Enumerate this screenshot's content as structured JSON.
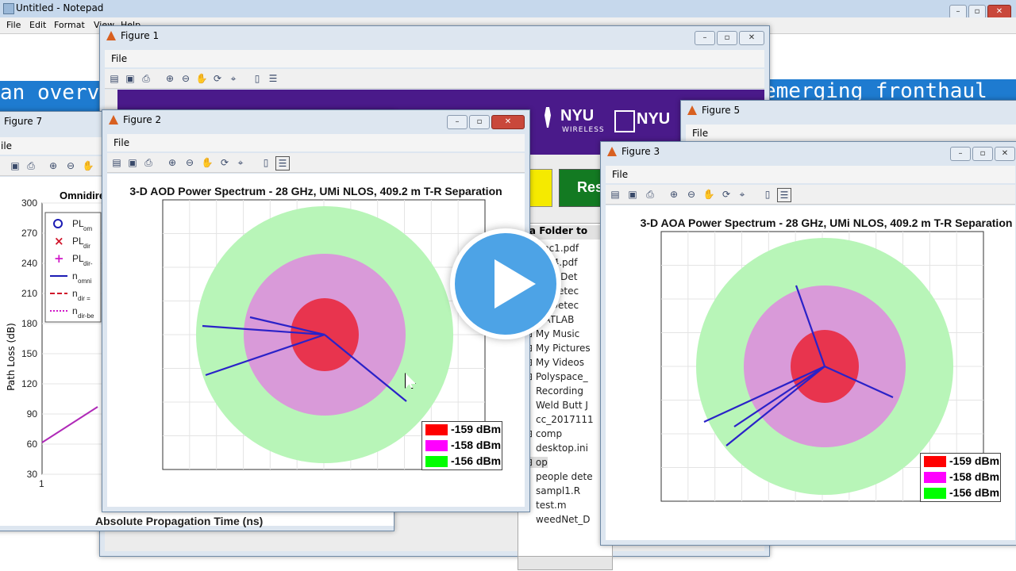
{
  "notepad": {
    "title": "Untitled - Notepad",
    "menu": [
      "File",
      "Edit",
      "Format",
      "View",
      "Help"
    ],
    "line1_left": "an overv",
    "line1_right": "emerging fronthaul"
  },
  "figure1": {
    "title": "Figure 1",
    "menu_file": "File",
    "banner_logo1": "NYU",
    "banner_logo1_sub": "WIRELESS",
    "banner_logo2": "NYU",
    "button_text": "Res",
    "tree_header": "t a Folder to",
    "tree": [
      "Doc1.pdf",
      "oc14.pdf",
      "Imet Det",
      "ne Detec",
      "ne Detec",
      "MATLAB",
      "My Music",
      "My Pictures",
      "My Videos",
      "Polyspace_",
      "Recording",
      "Weld Butt J",
      "cc_2017111",
      "comp",
      "desktop.ini",
      "op",
      "people dete",
      "sampl1.R",
      "test.m",
      "weedNet_D"
    ]
  },
  "figure7": {
    "title": "Figure 7",
    "menu_file": "ile",
    "plot_title": "Omnidire",
    "ylabel": "Path Loss (dB)",
    "xlabel": "Absolute Propagation Time (ns)",
    "yticks": [
      "300",
      "270",
      "240",
      "210",
      "180",
      "150",
      "120",
      "90",
      "60",
      "30"
    ],
    "xtick": "1",
    "legend": [
      {
        "symbol": "O",
        "base": "PL",
        "sub": "om",
        "color": "#1c1cb4"
      },
      {
        "symbol": "×",
        "base": "PL",
        "sub": "dir",
        "color": "#d0142a"
      },
      {
        "symbol": "+",
        "base": "PL",
        "sub": "dir-",
        "color": "#d018c8"
      },
      {
        "symbol": "line",
        "base": "n",
        "sub": "omni",
        "color": "#1c1cb4"
      },
      {
        "symbol": "dash",
        "base": "n",
        "sub": "dir =",
        "color": "#d0142a"
      },
      {
        "symbol": "dot",
        "base": "n",
        "sub": "dir-be",
        "color": "#d018c8"
      }
    ]
  },
  "figure2": {
    "title": "Figure 2",
    "menu_file": "File",
    "plot_title": "3-D AOD Power Spectrum - 28 GHz, UMi NLOS, 409.2 m T-R Separation",
    "legend": [
      {
        "label": "-159 dBm",
        "color": "#ff0000"
      },
      {
        "label": "-158 dBm",
        "color": "#ff00ff"
      },
      {
        "label": "-156 dBm",
        "color": "#00ff00"
      }
    ]
  },
  "figure5": {
    "title": "Figure 5",
    "menu_file": "File"
  },
  "figure3": {
    "title": "Figure 3",
    "menu_file": "File",
    "plot_title": "3-D AOA Power Spectrum - 28 GHz, UMi NLOS, 409.2 m T-R Separation",
    "legend": [
      {
        "label": "-159 dBm",
        "color": "#ff0000"
      },
      {
        "label": "-158 dBm",
        "color": "#ff00ff"
      },
      {
        "label": "-156 dBm",
        "color": "#00ff00"
      }
    ]
  },
  "colors": {
    "outer_ring": "#b8f5b8",
    "middle_ring": "#d99ad9",
    "inner_ring": "#e8344e",
    "lobe": "#2a22c8",
    "banner": "#4a1a8a"
  }
}
